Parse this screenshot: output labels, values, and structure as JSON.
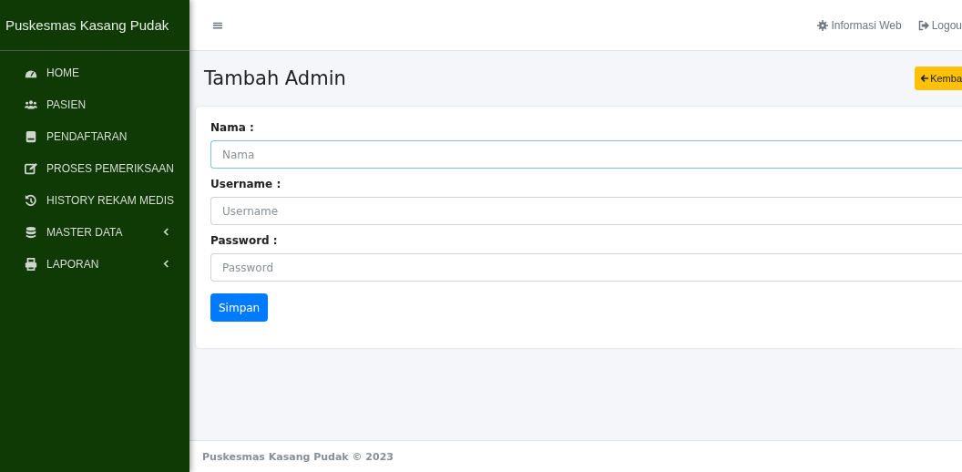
{
  "brand": "Puskesmas Kasang Pudak",
  "sidebar": {
    "items": [
      {
        "label": "HOME",
        "kind": "dashboard",
        "has_submenu": false
      },
      {
        "label": "PASIEN",
        "kind": "users",
        "has_submenu": false
      },
      {
        "label": "PENDAFTARAN",
        "kind": "book",
        "has_submenu": false
      },
      {
        "label": "PROSES PEMERIKSAAN",
        "kind": "edit",
        "has_submenu": false
      },
      {
        "label": "HISTORY REKAM MEDIS",
        "kind": "history",
        "has_submenu": false
      },
      {
        "label": "MASTER DATA",
        "kind": "database",
        "has_submenu": true
      },
      {
        "label": "LAPORAN",
        "kind": "print",
        "has_submenu": true
      }
    ]
  },
  "topbar": {
    "menu_icon": "≡",
    "links": [
      {
        "label": "Informasi Web",
        "kind": "settings"
      },
      {
        "label": "Logou",
        "kind": "logout"
      }
    ]
  },
  "page_title": "Tambah Admin",
  "back_button": {
    "label": "Kemba"
  },
  "form": {
    "fields": [
      {
        "label": "Nama :",
        "placeholder": "Nama",
        "focused": true
      },
      {
        "label": "Username :",
        "placeholder": "Username",
        "focused": false
      },
      {
        "label": "Password :",
        "placeholder": "Password",
        "focused": false
      }
    ],
    "submit": "Simpan"
  },
  "footer": "Puskesmas Kasang Pudak © 2023"
}
